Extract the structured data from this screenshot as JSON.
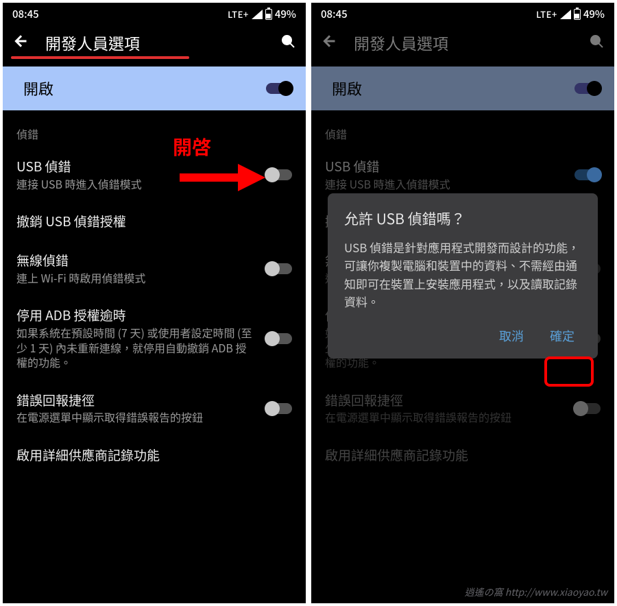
{
  "status": {
    "time": "08:45",
    "network": "LTE+",
    "battery": "49%"
  },
  "appbar": {
    "title": "開發人員選項"
  },
  "main_toggle": {
    "label": "開啟"
  },
  "section_debug": "偵錯",
  "settings": {
    "usb_debug": {
      "title": "USB 偵錯",
      "sub": "連接 USB 時進入偵錯模式"
    },
    "revoke": {
      "title": "撤銷 USB 偵錯授權"
    },
    "wireless": {
      "title": "無線偵錯",
      "sub": "連上 Wi-Fi 時啟用偵錯模式"
    },
    "adb_timeout": {
      "title": "停用 ADB 授權逾時",
      "sub": "如果系統在預設時間 (7 天) 或使用者設定時間 (至少 1 天) 內未重新連線，就停用自動撤銷 ADB 授權的功能。"
    },
    "bugreport": {
      "title": "錯誤回報捷徑",
      "sub": "在電源選單中顯示取得錯誤報告的按鈕"
    },
    "vendor_log": {
      "title": "啟用詳細供應商記錄功能"
    }
  },
  "annotation": {
    "open_label": "開啓"
  },
  "dialog": {
    "title": "允許 USB 偵錯嗎？",
    "body": "USB 偵錯是針對應用程式開發而設計的功能，可讓你複製電腦和裝置中的資料、不需經由通知即可在裝置上安裝應用程式，以及讀取記錄資料。",
    "cancel": "取消",
    "ok": "確定"
  },
  "watermark": "逍遙の窩   http://www.xiaoyao.tw"
}
